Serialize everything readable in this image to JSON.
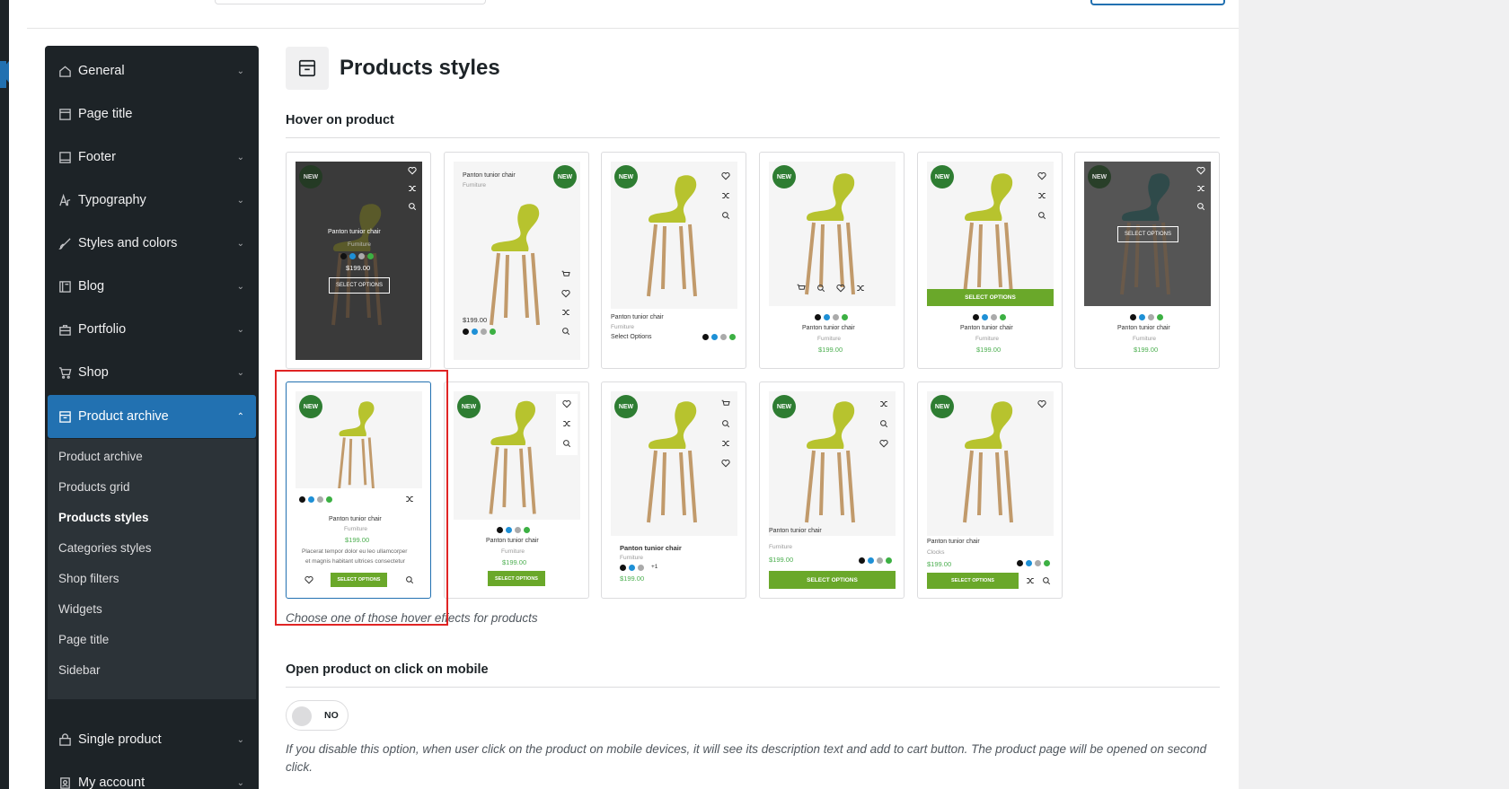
{
  "sidebar": {
    "items": [
      {
        "label": "General",
        "icon": "home-icon",
        "expanded": false
      },
      {
        "label": "Page title",
        "icon": "page-icon",
        "expanded": false
      },
      {
        "label": "Footer",
        "icon": "footer-icon",
        "expanded": false
      },
      {
        "label": "Typography",
        "icon": "typography-icon",
        "expanded": false
      },
      {
        "label": "Styles and colors",
        "icon": "brush-icon",
        "expanded": false
      },
      {
        "label": "Blog",
        "icon": "blog-icon",
        "expanded": false
      },
      {
        "label": "Portfolio",
        "icon": "briefcase-icon",
        "expanded": false
      },
      {
        "label": "Shop",
        "icon": "cart-icon",
        "expanded": false
      },
      {
        "label": "Product archive",
        "icon": "archive-icon",
        "expanded": true
      },
      {
        "label": "Single product",
        "icon": "bag-icon",
        "expanded": false
      },
      {
        "label": "My account",
        "icon": "account-icon",
        "expanded": false
      }
    ],
    "subitems": [
      {
        "label": "Product archive",
        "current": false
      },
      {
        "label": "Products grid",
        "current": false
      },
      {
        "label": "Products styles",
        "current": true
      },
      {
        "label": "Categories styles",
        "current": false
      },
      {
        "label": "Shop filters",
        "current": false
      },
      {
        "label": "Widgets",
        "current": false
      },
      {
        "label": "Page title",
        "current": false
      },
      {
        "label": "Sidebar",
        "current": false
      }
    ]
  },
  "main": {
    "title": "Products styles",
    "hover_section": "Hover on product",
    "hover_hint": "Choose one of those hover effects for products",
    "mobile_section": "Open product on click on mobile",
    "toggle_label": "NO",
    "mobile_desc": "If you disable this option, when user click on the product on mobile devices, it will see its description text and add to cart button. The product page will be opened on second click."
  },
  "product": {
    "name": "Panton tunior chair",
    "category": "Furniture",
    "category_alt": "Clocks",
    "price": "$199.00",
    "select_options": "SELECT OPTIONS",
    "select_options_alt": "Select Options",
    "new_badge": "NEW",
    "extra_colors": "+1",
    "short_desc_1": "Placerat tempor dolor eu leo ullamcorper",
    "short_desc_2": "et magnis habitant ultrices consectetur"
  },
  "colors": {
    "accent": "#2271b1",
    "sidebar_bg": "#1d2327",
    "new_badge": "#2e7d32",
    "button_green": "#6aa82a",
    "price_green": "#4caf50",
    "highlight": "#e02424",
    "swatches": [
      "#111111",
      "#1e90d6",
      "#aaaaaa",
      "#3cb043"
    ]
  }
}
